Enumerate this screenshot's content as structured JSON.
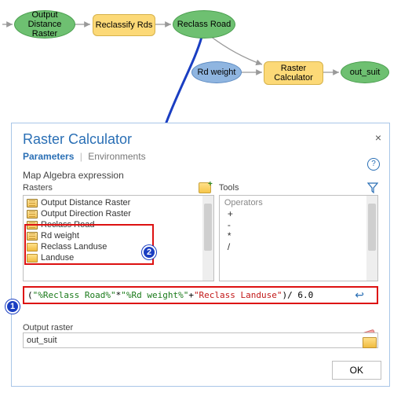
{
  "flow": {
    "nodes": {
      "output_distance": "Output Distance Raster",
      "reclassify_rds": "Reclassify Rds",
      "reclass_road": "Reclass Road",
      "rd_weight": "Rd weight",
      "raster_calculator": "Raster Calculator",
      "out_suit": "out_suit"
    }
  },
  "dialog": {
    "title": "Raster Calculator",
    "tabs": {
      "parameters": "Parameters",
      "environments": "Environments"
    },
    "expression_label": "Map Algebra expression",
    "rasters_label": "Rasters",
    "tools_label": "Tools",
    "rasters": [
      "Output Distance Raster",
      "Output Direction Raster",
      "Reclass Road",
      "Rd weight",
      "Reclass Landuse",
      "Landuse"
    ],
    "operators_label": "Operators",
    "operators": [
      "+",
      "-",
      "*",
      "/"
    ],
    "expression_tokens": {
      "p1": "(",
      "r1": "\"%Reclass Road%\"",
      "star": "  *  ",
      "r2": "\"%Rd weight%\"",
      "plus": " + ",
      "r3": "\"Reclass Landuse\"",
      "p2": ")",
      "div": " / 6.0"
    },
    "output_label": "Output raster",
    "output_value": "out_suit",
    "ok": "OK",
    "close": "×",
    "help": "?"
  },
  "badges": {
    "one": "1",
    "two": "2"
  }
}
